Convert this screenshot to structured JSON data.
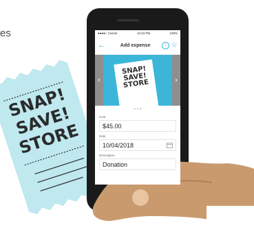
{
  "page": {
    "edge_text": "es"
  },
  "receipt_big": {
    "lines": [
      "SNAP!",
      "SAVE!",
      "STORE"
    ]
  },
  "status_bar": {
    "carrier": "●●●●○ Carrier",
    "time": "12:34 PM",
    "battery": "100%"
  },
  "nav": {
    "back_icon": "←",
    "title": "Add expense",
    "info_icon": "i",
    "star_icon": "☆"
  },
  "carousel": {
    "left_chevron": "‹",
    "right_chevron": "›",
    "receipt_lines": [
      "SNAP!",
      "SAVE!",
      "STORE"
    ],
    "indicator": "● ● ●"
  },
  "form": {
    "cost_label": "Cost",
    "cost_value": "$45.00",
    "date_label": "Date",
    "date_value": "10/04/2018",
    "description_label": "Description",
    "description_value": "Donation"
  },
  "colors": {
    "accent": "#3cb6d8",
    "receipt": "#bfe8ef",
    "skin": "#c99a6e",
    "phone": "#1a1a1a"
  }
}
